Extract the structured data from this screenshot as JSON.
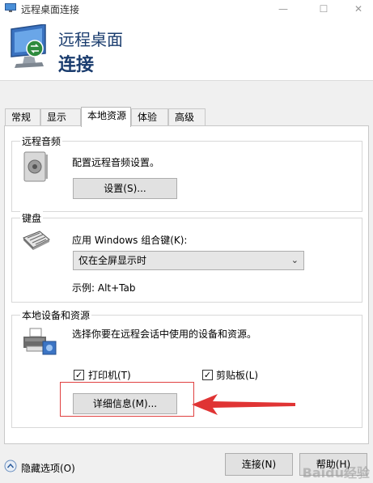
{
  "window": {
    "title": "远程桌面连接",
    "controls": {
      "minimize": "—",
      "maximize": "☐",
      "close": "✕"
    }
  },
  "header": {
    "line1": "远程桌面",
    "line2": "连接"
  },
  "tabs": [
    {
      "label": "常规",
      "active": false
    },
    {
      "label": "显示",
      "active": false
    },
    {
      "label": "本地资源",
      "active": true
    },
    {
      "label": "体验",
      "active": false
    },
    {
      "label": "高级",
      "active": false
    }
  ],
  "audio": {
    "group_label": "远程音频",
    "description": "配置远程音频设置。",
    "button_label": "设置(S)..."
  },
  "keyboard": {
    "group_label": "键盘",
    "description": "应用 Windows 组合键(K):",
    "selected": "仅在全屏显示时",
    "example": "示例: Alt+Tab"
  },
  "devices": {
    "group_label": "本地设备和资源",
    "description": "选择你要在远程会话中使用的设备和资源。",
    "printers_label": "打印机(T)",
    "printers_checked": true,
    "clipboard_label": "剪贴板(L)",
    "clipboard_checked": true,
    "more_button_label": "详细信息(M)..."
  },
  "footer": {
    "hide_options": "隐藏选项(O)",
    "connect": "连接(N)",
    "help": "帮助(H)"
  },
  "watermark": "Baidu经验",
  "colors": {
    "accent": "#1a3c6e",
    "highlight": "#e04040"
  }
}
